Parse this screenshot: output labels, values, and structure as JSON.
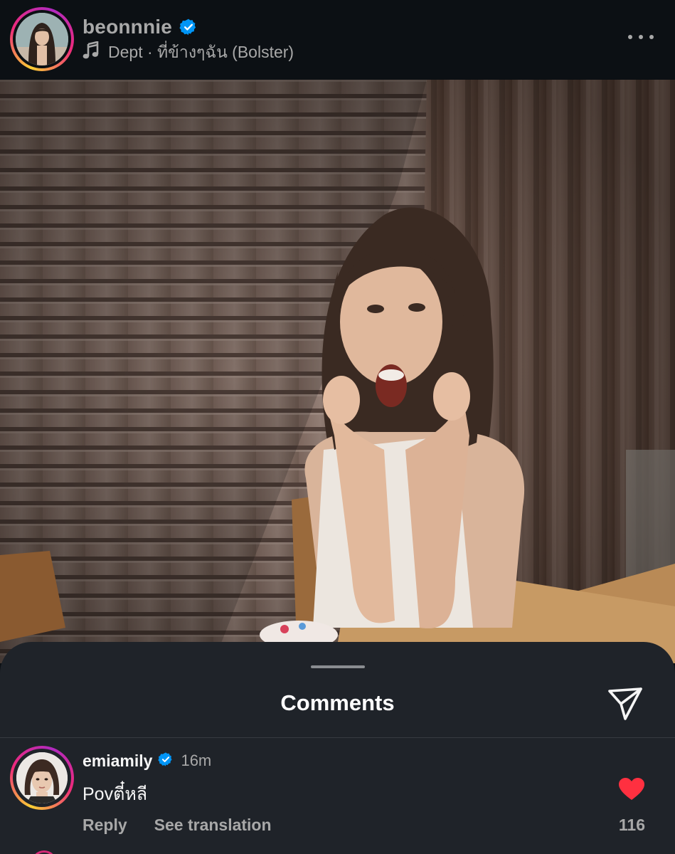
{
  "post": {
    "username": "beonnnie",
    "verified": true,
    "music": {
      "icon": "music-note-icon",
      "text": "Dept · ที่ข้างๆฉัน (Bolster)"
    },
    "more_icon": "more-horizontal-icon"
  },
  "comments_sheet": {
    "title": "Comments",
    "share_icon": "paper-plane-icon",
    "comments": [
      {
        "username": "emiamily",
        "verified": true,
        "time": "16m",
        "text": "Povตี๋หลี",
        "reply_label": "Reply",
        "translate_label": "See translation",
        "liked": true,
        "like_count": "116"
      }
    ]
  },
  "colors": {
    "background": "#0c1014",
    "sheet": "#1f2329",
    "verified_blue": "#0095f6",
    "like_red": "#ff3040",
    "secondary_text": "#a8a8a8"
  }
}
